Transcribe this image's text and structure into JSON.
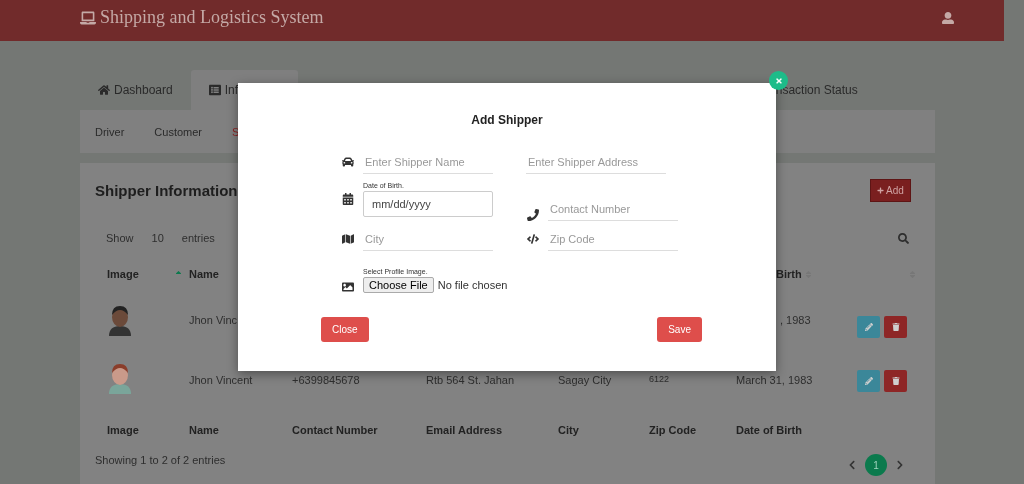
{
  "header": {
    "title": "Shipping and Logistics System"
  },
  "tabs": [
    {
      "label": "Dashboard",
      "selected": false
    },
    {
      "label": "Inf",
      "selected": true
    },
    {
      "label": "nsaction Status",
      "selected": false
    }
  ],
  "subnav": [
    {
      "label": "Driver",
      "selected": false
    },
    {
      "label": "Customer",
      "selected": false
    },
    {
      "label": "S",
      "selected": true
    }
  ],
  "card": {
    "title": "Shipper Information",
    "add_button": "Add",
    "length": {
      "show": "Show",
      "value": "10",
      "entries": "entries"
    },
    "header_columns": [
      "Image",
      "Name",
      "Birth"
    ],
    "rows": [
      {
        "name": "Jhon Vinc",
        "date_of_birth": ", 1983"
      },
      {
        "name": "Jhon Vincent",
        "contact": "+6399845678",
        "address": "Rtb 564 St. Jahan",
        "city": "Sagay City",
        "zip": "6122",
        "date_of_birth": "March 31, 1983"
      }
    ],
    "footer_columns": [
      "Image",
      "Name",
      "Contact Number",
      "Email Address",
      "City",
      "Zip Code",
      "Date of Birth"
    ],
    "info": "Showing 1 to 2 of 2 entries",
    "pagination": [
      {
        "label": "1",
        "selected": true
      }
    ]
  },
  "modal": {
    "title": "Add Shipper",
    "fields": [
      {
        "kind": "line",
        "placeholder": "Enter Shipper Name"
      },
      {
        "kind": "line",
        "placeholder": "Enter Shipper Address"
      },
      {
        "kind": "date",
        "label": "Date of Birth.",
        "placeholder": "mm/dd/yyyy"
      },
      {
        "kind": "line",
        "placeholder": "Contact Number"
      },
      {
        "kind": "line",
        "placeholder": "City"
      },
      {
        "kind": "line",
        "placeholder": "Zip Code"
      },
      {
        "kind": "file",
        "label": "Select Profile Image.",
        "button": "Choose File",
        "status": "No file chosen"
      }
    ],
    "buttons": [
      "Close",
      "Save"
    ]
  }
}
